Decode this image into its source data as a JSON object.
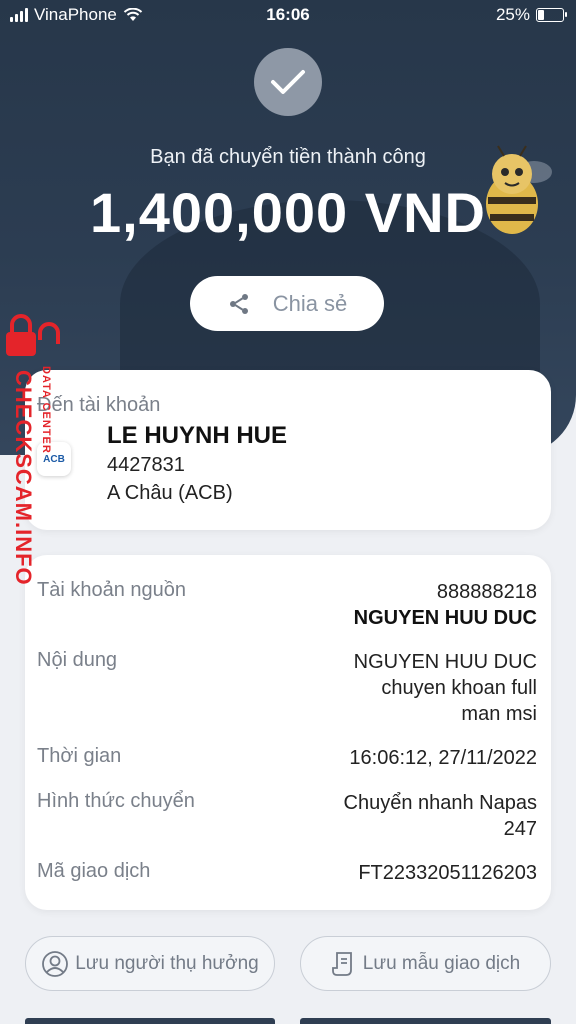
{
  "status_bar": {
    "carrier": "VinaPhone",
    "time": "16:06",
    "battery_percent": "25%"
  },
  "hero": {
    "success_message": "Bạn đã chuyển tiền thành công",
    "amount": "1,400,000 VND",
    "share_label": "Chia sẻ"
  },
  "destination": {
    "label": "Đến tài khoản",
    "name": "LE HUYNH HUE",
    "account_number": "4427831",
    "bank": "A Châu (ACB)",
    "bank_logo_text": "ACB"
  },
  "details": {
    "source_label": "Tài khoản nguồn",
    "source_account": "888888218",
    "source_name": "NGUYEN HUU DUC",
    "content_label": "Nội dung",
    "content_lines": [
      "NGUYEN HUU DUC",
      "chuyen khoan full",
      "man msi"
    ],
    "time_label": "Thời gian",
    "time_value": "16:06:12, 27/11/2022",
    "method_label": "Hình thức chuyển",
    "method_lines": [
      "Chuyển nhanh Napas",
      "247"
    ],
    "code_label": "Mã giao dịch",
    "code_value": "FT22332051126203"
  },
  "actions": {
    "save_beneficiary": "Lưu người thụ hưởng",
    "save_template": "Lưu mẫu giao dịch"
  },
  "watermark": {
    "main": "CHECKSCAM.INFO",
    "sub": "DATA CENTER"
  },
  "colors": {
    "hero_bg": "#2c3d52",
    "watermark_red": "#e4242a",
    "text_muted": "#7a808a"
  }
}
